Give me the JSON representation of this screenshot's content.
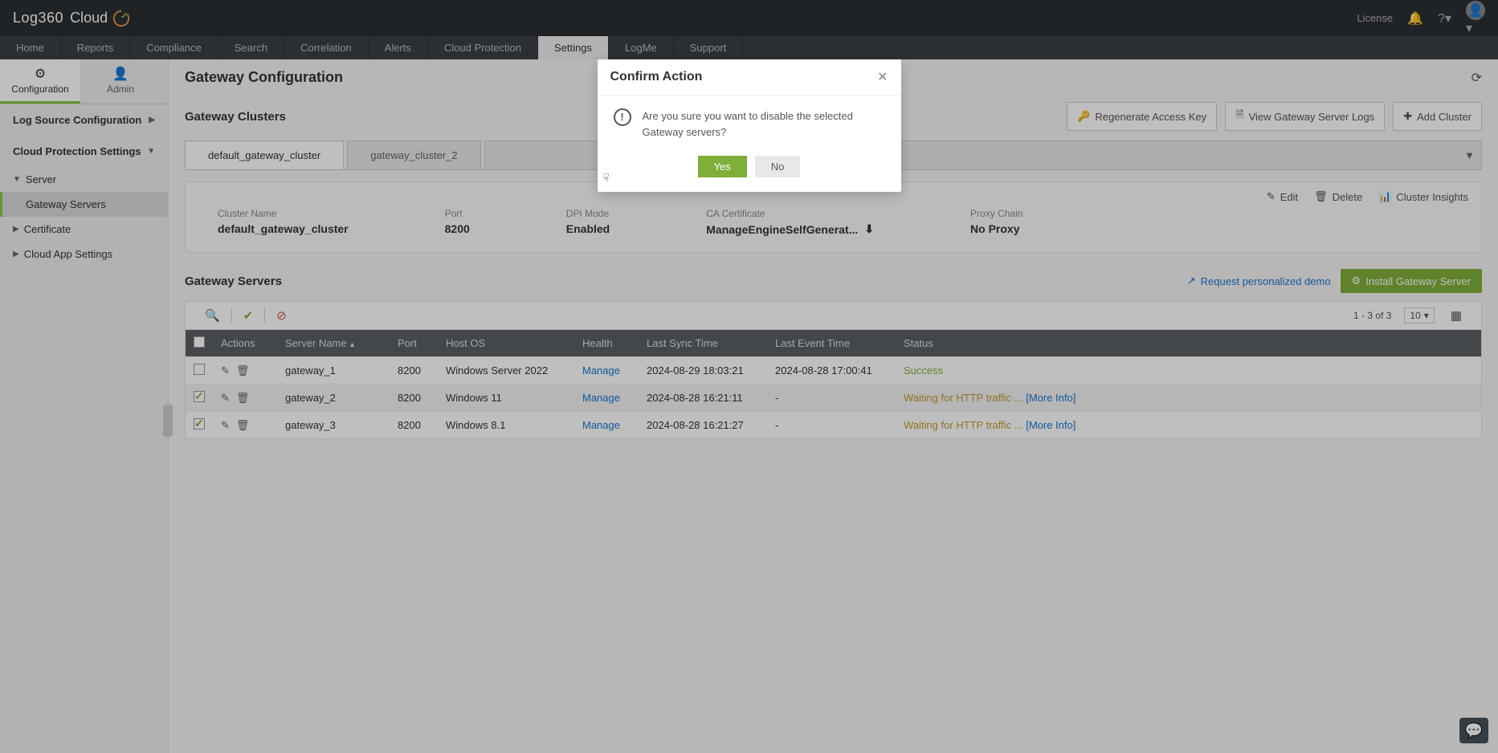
{
  "brand": {
    "name": "Log360",
    "suffix": "Cloud"
  },
  "topbar": {
    "license": "License"
  },
  "nav": {
    "items": [
      "Home",
      "Reports",
      "Compliance",
      "Search",
      "Correlation",
      "Alerts",
      "Cloud Protection",
      "Settings",
      "LogMe",
      "Support"
    ],
    "activeIndex": 7
  },
  "subtabs": {
    "config": "Configuration",
    "admin": "Admin"
  },
  "sidebar": {
    "logSource": "Log Source Configuration",
    "cloudProt": "Cloud Protection Settings",
    "server": "Server",
    "gateway": "Gateway Servers",
    "certificate": "Certificate",
    "cloudApp": "Cloud App Settings"
  },
  "page": {
    "title": "Gateway Configuration",
    "clustersTitle": "Gateway Clusters",
    "regenKey": "Regenerate Access Key",
    "viewLogs": "View Gateway Server Logs",
    "addCluster": "Add Cluster"
  },
  "clusterTabs": [
    "default_gateway_cluster",
    "gateway_cluster_2"
  ],
  "clusterCard": {
    "edit": "Edit",
    "delete": "Delete",
    "insights": "Cluster Insights",
    "fields": {
      "nameLabel": "Cluster Name",
      "nameValue": "default_gateway_cluster",
      "portLabel": "Port",
      "portValue": "8200",
      "dpiLabel": "DPI Mode",
      "dpiValue": "Enabled",
      "caLabel": "CA Certificate",
      "caValue": "ManageEngineSelfGenerat...",
      "proxyLabel": "Proxy Chain",
      "proxyValue": "No Proxy"
    }
  },
  "servers": {
    "title": "Gateway Servers",
    "demo": "Request personalized demo",
    "install": "Install Gateway Server",
    "pageInfo": "1 - 3 of 3",
    "pageSize": "10",
    "columns": {
      "actions": "Actions",
      "name": "Server Name",
      "port": "Port",
      "os": "Host OS",
      "health": "Health",
      "sync": "Last Sync Time",
      "event": "Last Event Time",
      "status": "Status"
    },
    "rows": [
      {
        "checked": false,
        "name": "gateway_1",
        "port": "8200",
        "os": "Windows Server 2022",
        "health": "Manage",
        "sync": "2024-08-29 18:03:21",
        "event": "2024-08-28 17:00:41",
        "status": "Success",
        "statusClass": "success",
        "more": ""
      },
      {
        "checked": true,
        "name": "gateway_2",
        "port": "8200",
        "os": "Windows 11",
        "health": "Manage",
        "sync": "2024-08-28 16:21:11",
        "event": "-",
        "status": "Waiting for HTTP traffic ...",
        "statusClass": "warn",
        "more": "[More Info]"
      },
      {
        "checked": true,
        "name": "gateway_3",
        "port": "8200",
        "os": "Windows 8.1",
        "health": "Manage",
        "sync": "2024-08-28 16:21:27",
        "event": "-",
        "status": "Waiting for HTTP traffic ...",
        "statusClass": "warn",
        "more": "[More Info]"
      }
    ]
  },
  "modal": {
    "title": "Confirm Action",
    "message": "Are you sure you want to disable the selected Gateway servers?",
    "yes": "Yes",
    "no": "No"
  }
}
